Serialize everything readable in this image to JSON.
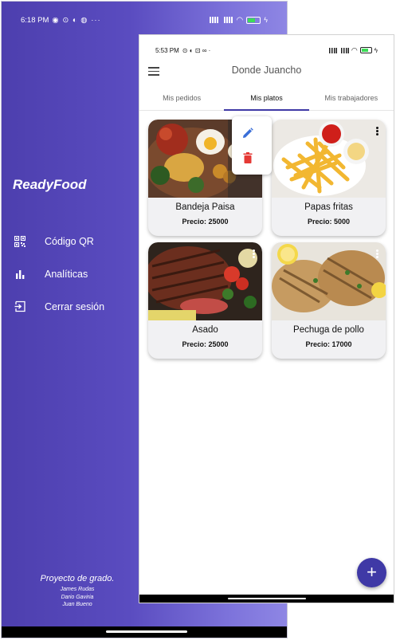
{
  "back_status": {
    "time": "6:18 PM",
    "icons": "◉ ⊙ ◐ ◍ ···",
    "battery": "15"
  },
  "drawer": {
    "brand": "ReadyFood",
    "menu": [
      {
        "label": "Código QR",
        "icon": "qr-code-icon"
      },
      {
        "label": "Analíticas",
        "icon": "bar-chart-icon"
      },
      {
        "label": "Cerrar sesión",
        "icon": "logout-icon"
      }
    ],
    "footer_title": "Proyecto de grado.",
    "footer_names": [
      "James Rudas",
      "Dario Gaviria",
      "Juan Bueno"
    ]
  },
  "front_status": {
    "time": "5:53 PM",
    "icons": "⊙ ◐ ⊡ ∞ ·"
  },
  "appbar": {
    "title": "Donde Juancho"
  },
  "tabs": [
    "Mis pedidos",
    "Mis platos",
    "Mis trabajadores"
  ],
  "active_tab": 1,
  "dishes": [
    {
      "name": "Bandeja Paisa",
      "price": "Precio: 25000"
    },
    {
      "name": "Papas fritas",
      "price": "Precio: 5000"
    },
    {
      "name": "Asado",
      "price": "Precio: 25000"
    },
    {
      "name": "Pechuga de pollo",
      "price": "Precio: 17000"
    }
  ],
  "popup_actions": [
    "edit-icon",
    "delete-icon"
  ],
  "colors": {
    "accent": "#3f39a6",
    "drawer_start": "#4d3fae",
    "drawer_end": "#8e86e4",
    "edit": "#3b6fd8",
    "delete": "#e53935"
  },
  "fab_label": "+"
}
